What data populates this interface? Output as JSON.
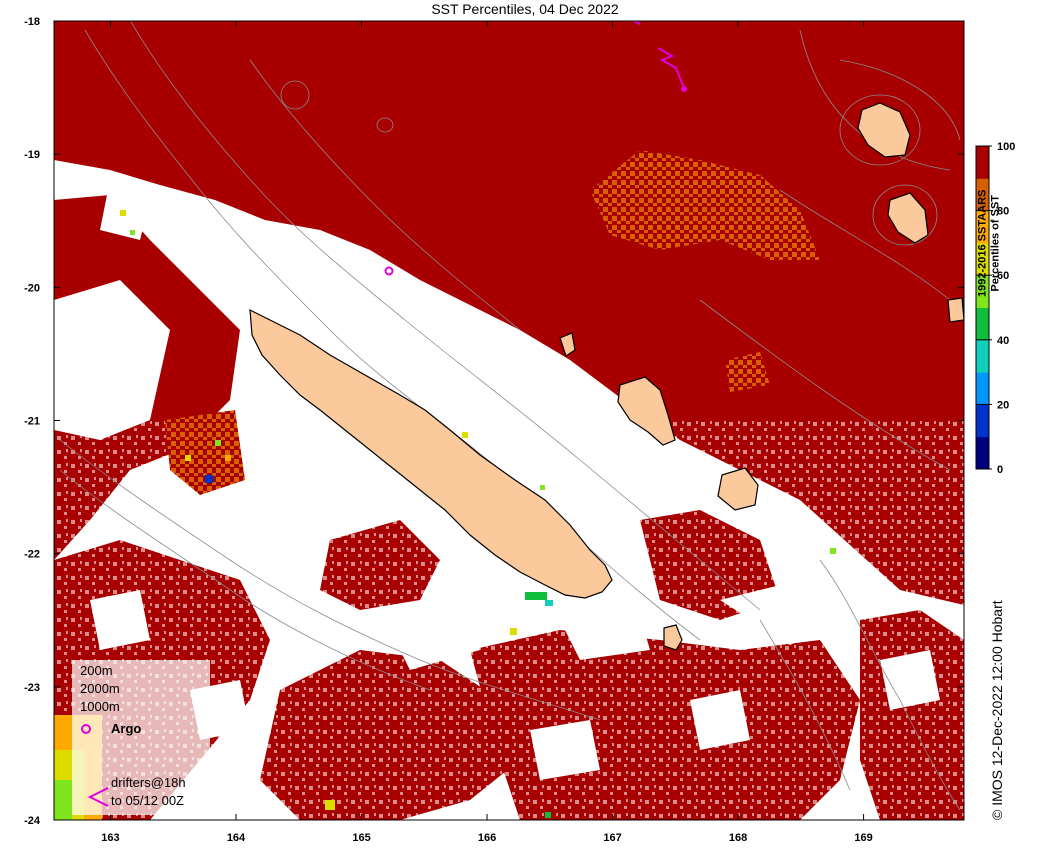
{
  "map": {
    "title": "SST Percentiles, 04 Dec 2022",
    "credit": "© IMOS 12-Dec-2022 12:00 Hobart",
    "lat_ticks": [
      "-18",
      "-19",
      "-20",
      "-21",
      "-22",
      "-23",
      "-24"
    ],
    "lon_ticks": [
      "163",
      "164",
      "165",
      "166",
      "167",
      "168",
      "169"
    ],
    "lat_range": [
      -24,
      -18
    ],
    "lon_range": [
      162.55,
      169.8
    ],
    "land_color": "#fbc99b",
    "no_data_color": "#ffffff"
  },
  "colorbar": {
    "label_line1": "1992-2016 SSTAARS",
    "label_line2": "Percentiles of SST",
    "ticks": [
      "0",
      "20",
      "40",
      "60",
      "80",
      "100"
    ],
    "range": [
      0,
      100
    ],
    "bands": [
      "#00007f",
      "#0033cc",
      "#0096ff",
      "#10cfbb",
      "#0fbf3b",
      "#7fe51f",
      "#dcdc00",
      "#ffaa00",
      "#d86000",
      "#a80000"
    ]
  },
  "legend": {
    "contour_200": "200m",
    "contour_2000": "2000m",
    "contour_1000": "1000m",
    "argo": "Argo",
    "drifters_line1": "drifters@18h",
    "drifters_line2": "to 05/12 00Z"
  }
}
